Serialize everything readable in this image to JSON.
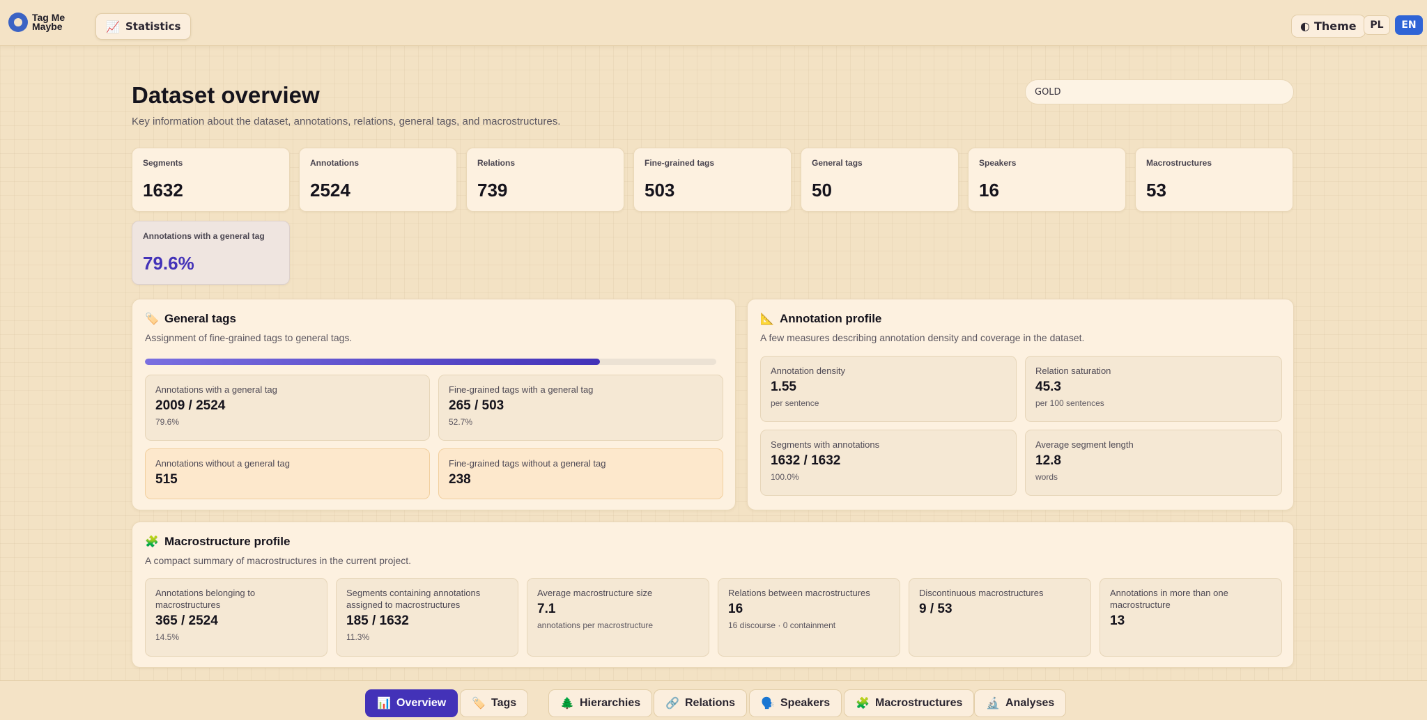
{
  "app": {
    "logo_text_line1": "Tag Me",
    "logo_text_line2": "Maybe",
    "statistics_label": "Statistics",
    "theme_label": "Theme",
    "lang_pl": "PL",
    "lang_en": "EN",
    "accent_color": "#4332b8",
    "lang_active_color": "#2f64d6"
  },
  "header": {
    "title": "Dataset overview",
    "subtitle": "Key information about the dataset, annotations, relations, general tags, and macrostructures.",
    "dataset_value": "GOLD"
  },
  "stats": [
    {
      "label": "Segments",
      "value": "1632"
    },
    {
      "label": "Annotations",
      "value": "2524"
    },
    {
      "label": "Relations",
      "value": "739"
    },
    {
      "label": "Fine-grained tags",
      "value": "503"
    },
    {
      "label": "General tags",
      "value": "50"
    },
    {
      "label": "Speakers",
      "value": "16"
    },
    {
      "label": "Macrostructures",
      "value": "53"
    },
    {
      "label": "Annotations with a general tag",
      "value": "79.6%"
    }
  ],
  "general_tags": {
    "title": "General tags",
    "icon": "tag-icon",
    "description": "Assignment of fine-grained tags to general tags.",
    "progress_fraction": 0.796,
    "metrics": [
      {
        "label": "Annotations with a general tag",
        "value": "2009 / 2524",
        "sub": "79.6%"
      },
      {
        "label": "Fine-grained tags with a general tag",
        "value": "265 / 503",
        "sub": "52.7%"
      },
      {
        "label": "Annotations without a general tag",
        "value": "515"
      },
      {
        "label": "Fine-grained tags without a general tag",
        "value": "238"
      }
    ]
  },
  "annotation_profile": {
    "title": "Annotation profile",
    "icon": "triangle-ruler-icon",
    "description": "A few measures describing annotation density and coverage in the dataset.",
    "metrics": [
      {
        "label": "Annotation density",
        "value": "1.55",
        "sub": "per sentence"
      },
      {
        "label": "Relation saturation",
        "value": "45.3",
        "sub": "per 100 sentences"
      },
      {
        "label": "Segments with annotations",
        "value": "1632 / 1632",
        "sub": "100.0%"
      },
      {
        "label": "Average segment length",
        "value": "12.8",
        "sub": "words"
      }
    ]
  },
  "macro_profile": {
    "title": "Macrostructure profile",
    "icon": "puzzle-icon",
    "description": "A compact summary of macrostructures in the current project.",
    "metrics": [
      {
        "label": "Annotations belonging to macrostructures",
        "value": "365 / 2524",
        "sub": "14.5%"
      },
      {
        "label": "Segments containing annotations assigned to macrostructures",
        "value": "185 / 1632",
        "sub": "11.3%"
      },
      {
        "label": "Average macrostructure size",
        "value": "7.1",
        "sub": "annotations per macrostructure"
      },
      {
        "label": "Relations between macrostructures",
        "value": "16",
        "sub": "16 discourse · 0 containment"
      },
      {
        "label": "Discontinuous macrostructures",
        "value": "9 / 53"
      },
      {
        "label": "Annotations in more than one macrostructure",
        "value": "13"
      }
    ]
  },
  "nav": [
    {
      "label": "Overview",
      "icon": "bar-chart-icon",
      "active": true
    },
    {
      "label": "Tags",
      "icon": "tag-icon"
    },
    {
      "label": "Hierarchies",
      "icon": "tree-icon"
    },
    {
      "label": "Relations",
      "icon": "link-icon"
    },
    {
      "label": "Speakers",
      "icon": "speaking-head-icon"
    },
    {
      "label": "Macrostructures",
      "icon": "puzzle-icon"
    },
    {
      "label": "Analyses",
      "icon": "microscope-icon"
    }
  ]
}
